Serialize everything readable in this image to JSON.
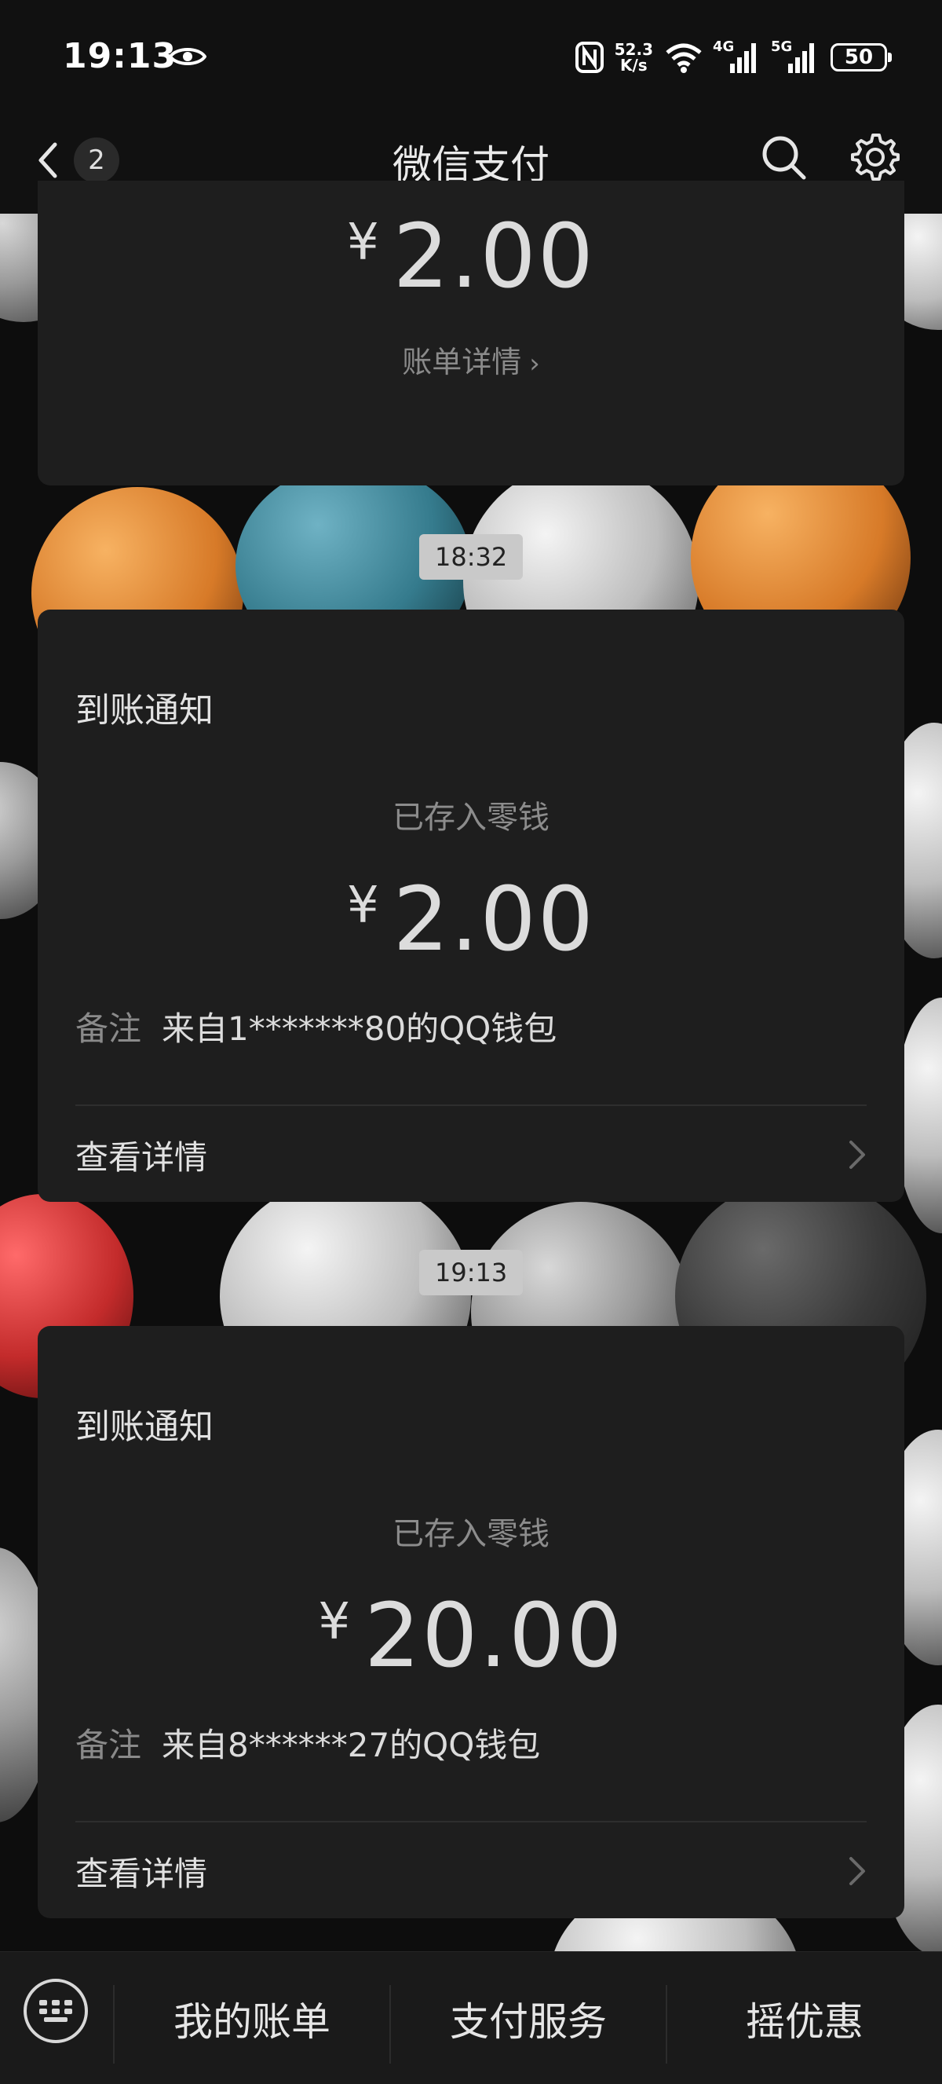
{
  "status_bar": {
    "time": "19:13",
    "net_speed_value": "52.3",
    "net_speed_unit": "K/s",
    "signal1_label": "4G",
    "signal2_label": "5G",
    "battery": "50"
  },
  "header": {
    "back_count": "2",
    "title": "微信支付"
  },
  "messages": [
    {
      "amount_yen": "¥",
      "amount": "2.00",
      "bill_link": "账单详情"
    },
    {
      "timestamp": "18:32",
      "title": "到账通知",
      "subtitle": "已存入零钱",
      "amount_yen": "¥",
      "amount": "2.00",
      "remark_key": "备注",
      "remark_value": "来自1*******80的QQ钱包",
      "detail_label": "查看详情"
    },
    {
      "timestamp": "19:13",
      "title": "到账通知",
      "subtitle": "已存入零钱",
      "amount_yen": "¥",
      "amount": "20.00",
      "remark_key": "备注",
      "remark_value": "来自8******27的QQ钱包",
      "detail_label": "查看详情"
    }
  ],
  "bottom_bar": {
    "tabs": [
      "我的账单",
      "支付服务",
      "摇优惠"
    ]
  }
}
